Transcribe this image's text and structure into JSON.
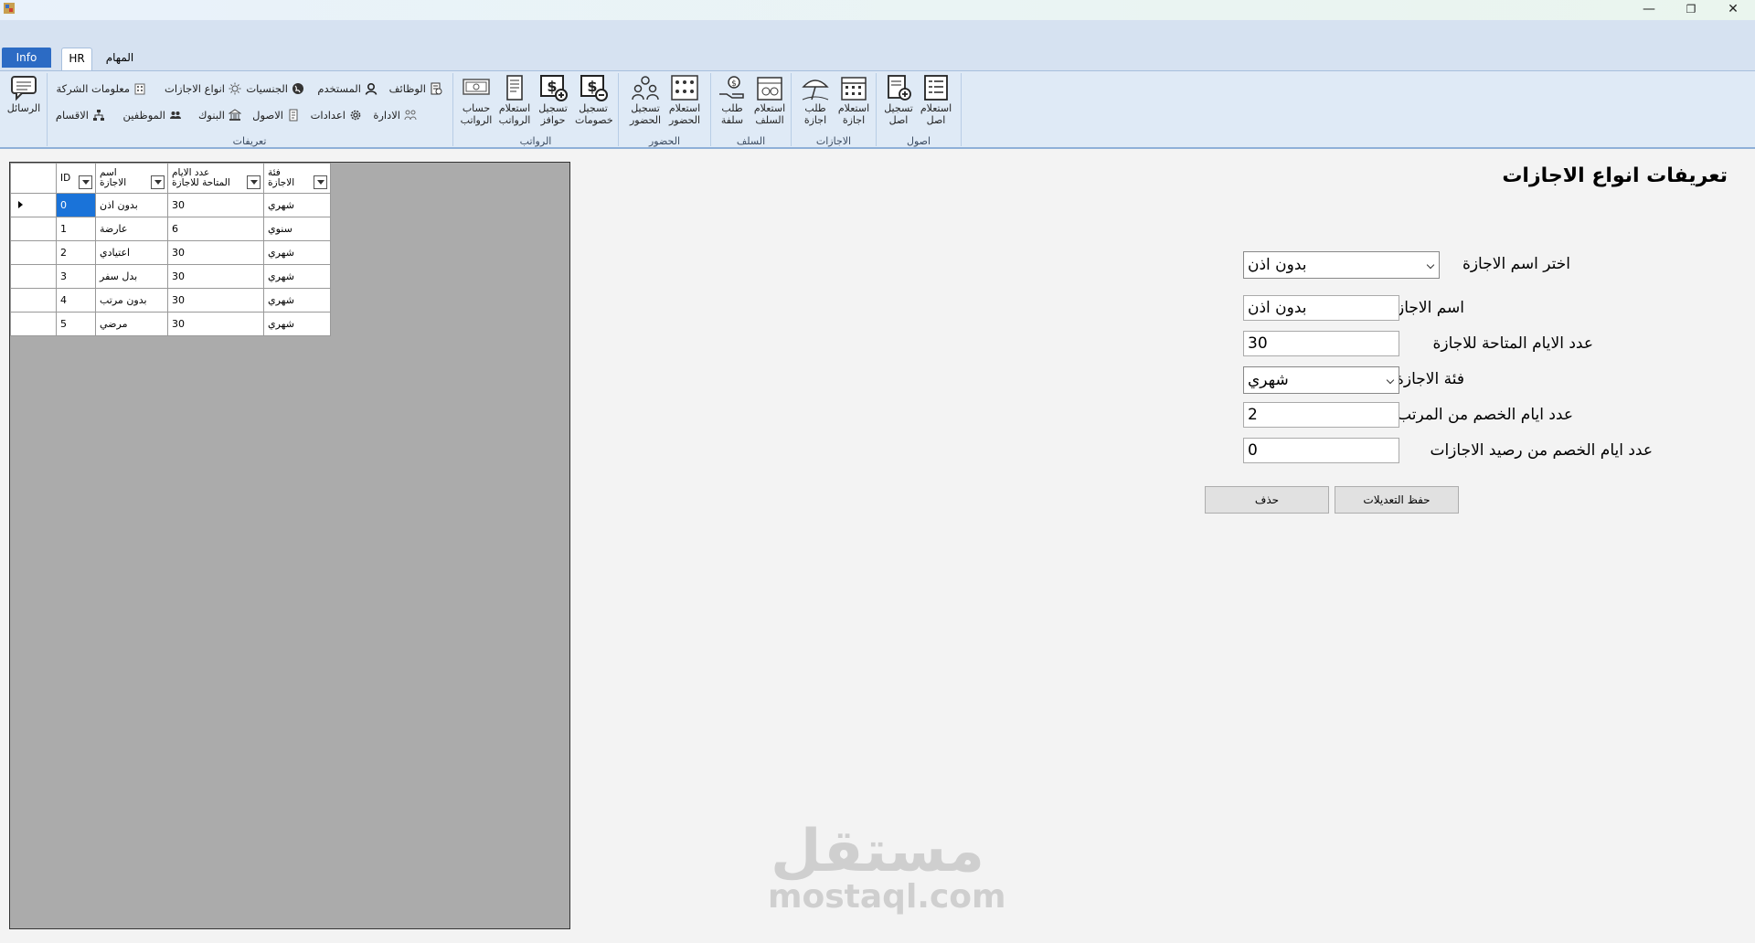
{
  "titlebar": {
    "minimize": "—",
    "restore": "❐",
    "close": "✕"
  },
  "tabs": {
    "info": "Info",
    "hr": "HR",
    "tasks": "المهام"
  },
  "ribbon": {
    "messages": "الرسائل",
    "groups": {
      "definitions": "تعريفات",
      "salaries": "الرواتب",
      "attendance": "الحضور",
      "advances": "السلف",
      "leaves": "الاجازات",
      "assets": "اصول"
    },
    "small": {
      "jobs": "الوظائف",
      "user": "المستخدم",
      "nationalities": "الجنسيات",
      "leave_types": "انواع الاجازات",
      "company_info": "معلومات الشركة",
      "administration": "الادارة",
      "settings": "اعدادات",
      "assets": "الاصول",
      "banks": "البنوك",
      "employees": "الموظفين",
      "departments": "الاقسام"
    },
    "big": {
      "salary_calc": [
        "حساب",
        "الرواتب"
      ],
      "salary_query": [
        "استعلام",
        "الرواتب"
      ],
      "incentives": [
        "تسجيل",
        "حوافز"
      ],
      "deductions": [
        "تسجيل",
        "خصومات"
      ],
      "attendance_reg": [
        "تسجيل",
        "الحضور"
      ],
      "attendance_query": [
        "استعلام",
        "الحضور"
      ],
      "advance_req": [
        "طلب",
        "سلفة"
      ],
      "advance_query": [
        "استعلام",
        "السلف"
      ],
      "leave_req": [
        "طلب",
        "اجازة"
      ],
      "leave_query": [
        "استعلام",
        "اجازة"
      ],
      "asset_reg": [
        "تسجيل",
        "اصل"
      ],
      "asset_query": [
        "استعلام",
        "اصل"
      ]
    }
  },
  "grid": {
    "headers": {
      "id": "ID",
      "name": [
        "اسم",
        "الاجازة"
      ],
      "days": [
        "عدد الايام",
        "المتاحة للاجازة"
      ],
      "category": [
        "فئة",
        "الاجازة"
      ]
    },
    "rows": [
      {
        "id": "0",
        "name": "بدون اذن",
        "days": "30",
        "category": "شهري"
      },
      {
        "id": "1",
        "name": "عارضة",
        "days": "6",
        "category": "سنوي"
      },
      {
        "id": "2",
        "name": "اعتيادي",
        "days": "30",
        "category": "شهري"
      },
      {
        "id": "3",
        "name": "بدل سفر",
        "days": "30",
        "category": "شهري"
      },
      {
        "id": "4",
        "name": "بدون مرتب",
        "days": "30",
        "category": "شهري"
      },
      {
        "id": "5",
        "name": "مرضي",
        "days": "30",
        "category": "شهري"
      }
    ]
  },
  "form": {
    "title": "تعريفات انواع الاجازات",
    "select_label": "اختر اسم الاجازة",
    "select_value": "بدون اذن",
    "name_label": "اسم الاجازة",
    "name_value": "بدون اذن",
    "days_label": "عدد الايام المتاحة للاجازة",
    "days_value": "30",
    "category_label": "فئة الاجازة",
    "category_value": "شهري",
    "salary_deduct_label": "عدد ايام الخصم من المرتب",
    "salary_deduct_value": "2",
    "balance_deduct_label": "عدد ايام الخصم من رصيد الاجازات",
    "balance_deduct_value": "0",
    "save_button": "حفظ التعديلات",
    "delete_button": "حذف"
  },
  "watermark": {
    "arabic": "مستقل",
    "latin": "mostaql.com"
  }
}
